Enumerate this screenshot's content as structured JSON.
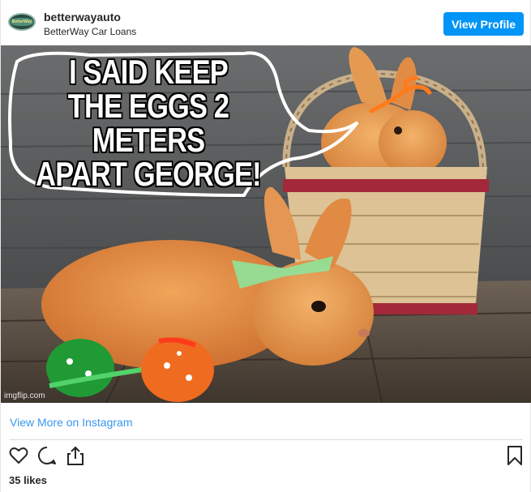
{
  "header": {
    "username": "betterwayauto",
    "subtitle": "BetterWay Car Loans",
    "view_profile_label": "View Profile",
    "avatar_text": "BetterWay"
  },
  "post": {
    "meme_text_lines": [
      "I SAID KEEP",
      "THE EGGS 2 METERS",
      "APART GEORGE!"
    ],
    "watermark": "imgflip.com"
  },
  "footer": {
    "view_more_label": "View More on Instagram",
    "likes": "35 likes"
  },
  "icons": {
    "like": "heart-icon",
    "comment": "comment-icon",
    "share": "share-icon",
    "save": "bookmark-icon"
  },
  "colors": {
    "button": "#0095f6",
    "link": "#3897f0"
  }
}
